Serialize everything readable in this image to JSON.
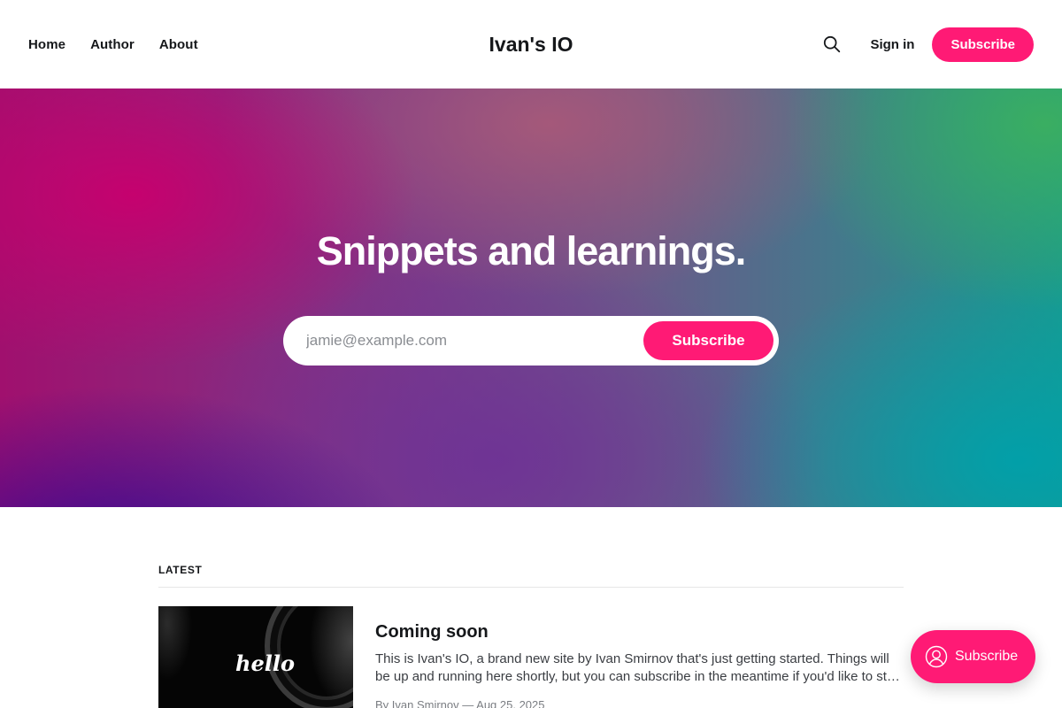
{
  "header": {
    "nav": [
      {
        "label": "Home"
      },
      {
        "label": "Author"
      },
      {
        "label": "About"
      }
    ],
    "site_title": "Ivan's IO",
    "search_icon": "search-icon",
    "signin_label": "Sign in",
    "subscribe_label": "Subscribe"
  },
  "hero": {
    "title": "Snippets and learnings.",
    "email_placeholder": "jamie@example.com",
    "submit_label": "Subscribe"
  },
  "latest": {
    "section_label": "LATEST",
    "posts": [
      {
        "thumbnail_text": "hello",
        "title": "Coming soon",
        "excerpt": "This is Ivan's IO, a brand new site by Ivan Smirnov that's just getting started. Things will be up and running here shortly, but you can subscribe in the meantime if you'd like to stay up to date.",
        "meta": "By Ivan Smirnov — Aug 25, 2025"
      }
    ]
  },
  "portal": {
    "label": "Subscribe",
    "icon": "user-circle-icon"
  },
  "colors": {
    "accent": "#ff1a75",
    "text": "#15171a"
  }
}
